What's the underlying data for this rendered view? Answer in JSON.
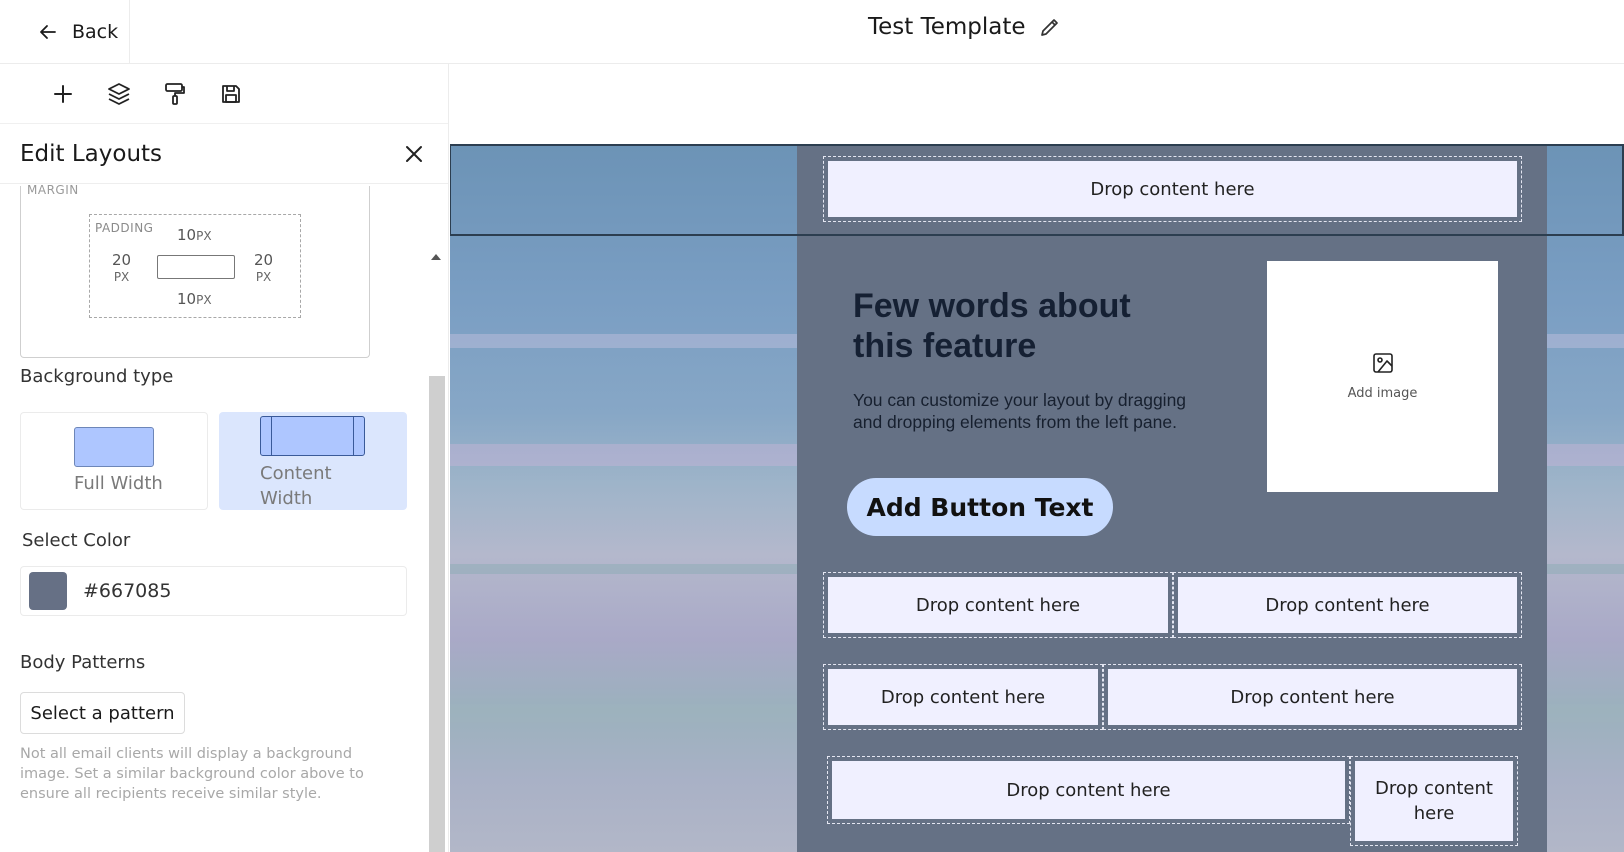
{
  "header": {
    "back_label": "Back",
    "title": "Test Template"
  },
  "toolbar": {
    "icons": [
      "plus-icon",
      "layers-icon",
      "paint-roller-icon",
      "save-icon"
    ]
  },
  "panel": {
    "title": "Edit Layouts",
    "margin_label": "MARGIN",
    "padding_label": "PADDING",
    "padding": {
      "top": "10",
      "bottom": "10",
      "left": "20",
      "right": "20",
      "unit": "PX"
    },
    "background_type_label": "Background type",
    "bg_options": [
      {
        "label": "Full Width",
        "selected": false
      },
      {
        "label": "Content Width",
        "selected": true
      }
    ],
    "select_color_label": "Select Color",
    "color_value": "#667085",
    "body_patterns_label": "Body Patterns",
    "select_pattern_label": "Select a pattern",
    "hint": "Not all email clients will display a background image. Set a similar background color above to ensure all recipients receive similar style."
  },
  "canvas": {
    "drop_label": "Drop content here",
    "headline": "Few words about this feature",
    "subtext": "You can customize your layout by dragging and dropping elements from the left pane.",
    "add_image_label": "Add image",
    "button_text": "Add Button Text",
    "content_bg": "#657185",
    "drop_bg": "#f0f0ff",
    "button_bg": "#c7dbff"
  }
}
